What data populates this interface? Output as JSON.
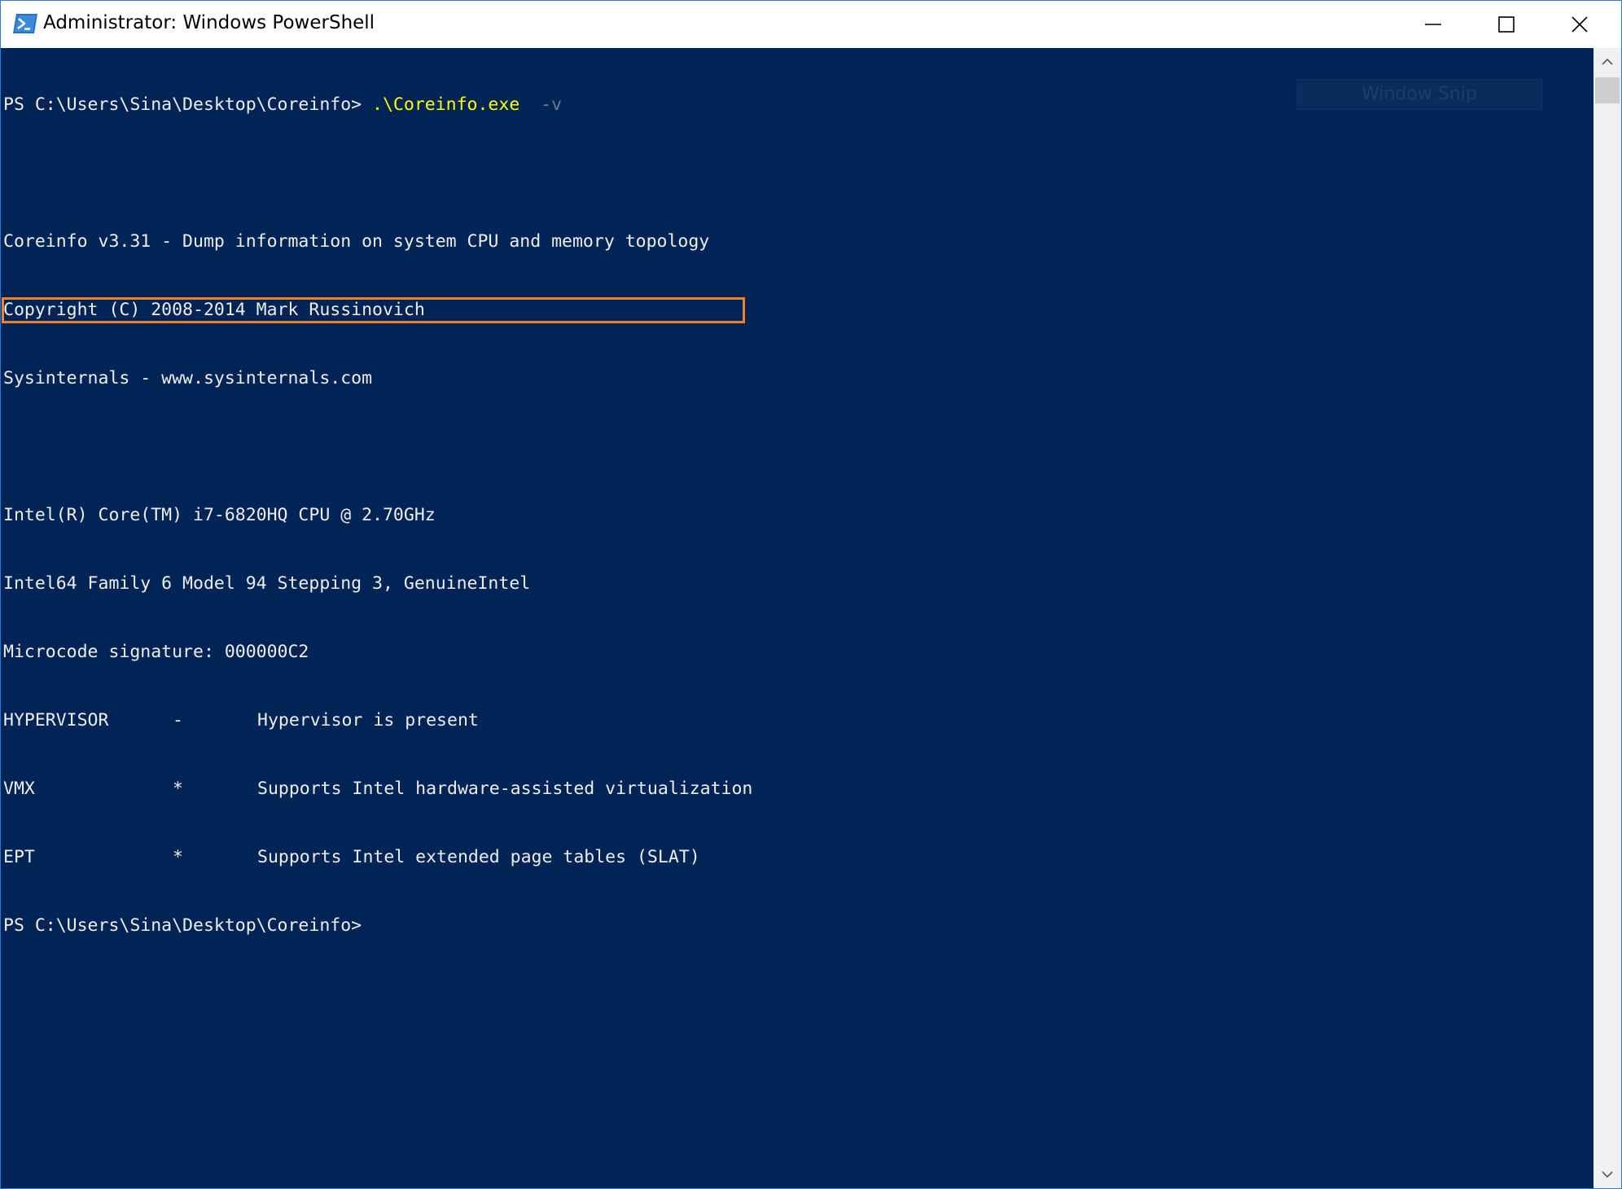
{
  "window": {
    "title": "Administrator: Windows PowerShell"
  },
  "icons": {
    "app": "powershell-icon",
    "minimize": "minimize-icon",
    "maximize": "maximize-icon",
    "close": "close-icon",
    "scroll_up": "chevron-up-icon",
    "scroll_down": "chevron-down-icon"
  },
  "colors": {
    "console_background": "#012456",
    "console_text": "#eeedf0",
    "command_text": "#ffff00",
    "parameter_text": "#6c7b8e",
    "highlight_box": "#f0822d"
  },
  "console": {
    "prompt_1": "PS C:\\Users\\Sina\\Desktop\\Coreinfo> ",
    "command": ".\\Coreinfo.exe",
    "parameter": "  -v",
    "header_lines": [
      "Coreinfo v3.31 - Dump information on system CPU and memory topology",
      "Copyright (C) 2008-2014 Mark Russinovich",
      "Sysinternals - www.sysinternals.com"
    ],
    "cpu_lines": [
      "Intel(R) Core(TM) i7-6820HQ CPU @ 2.70GHz",
      "Intel64 Family 6 Model 94 Stepping 3, GenuineIntel",
      "Microcode signature: 000000C2"
    ],
    "features": [
      {
        "name": "HYPERVISOR",
        "flag": "-",
        "description": "Hypervisor is present"
      },
      {
        "name": "VMX",
        "flag": "*",
        "description": "Supports Intel hardware-assisted virtualization"
      },
      {
        "name": "EPT",
        "flag": "*",
        "description": "Supports Intel extended page tables (SLAT)"
      }
    ],
    "prompt_2": "PS C:\\Users\\Sina\\Desktop\\Coreinfo>"
  },
  "overlay": {
    "ghost_label": "Window Snip"
  }
}
